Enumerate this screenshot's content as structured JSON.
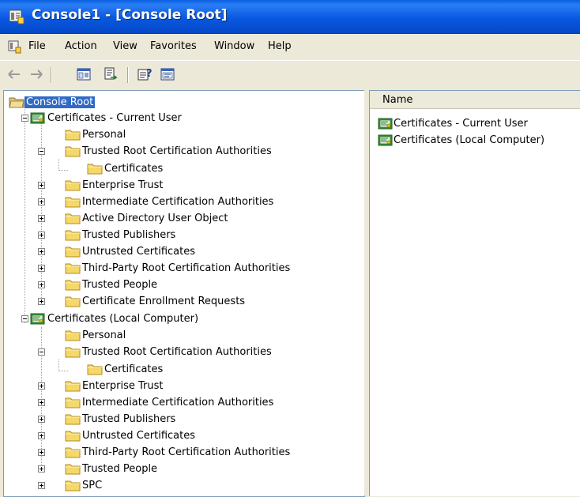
{
  "window": {
    "title": "Console1 - [Console Root]"
  },
  "menu": {
    "items": [
      "File",
      "Action",
      "View",
      "Favorites",
      "Window",
      "Help"
    ]
  },
  "toolbar": {
    "buttons": [
      "back-arrow-icon",
      "forward-arrow-icon",
      "show-hide-tree-icon",
      "export-list-icon",
      "help-icon",
      "properties-icon"
    ]
  },
  "tree": {
    "root": "Console Root",
    "current_user": {
      "label": "Certificates - Current User",
      "personal": "Personal",
      "trusted_root": "Trusted Root Certification Authorities",
      "trusted_root_certs": "Certificates",
      "enterprise_trust": "Enterprise Trust",
      "intermediate": "Intermediate Certification Authorities",
      "ad_user_object": "Active Directory User Object",
      "trusted_publishers": "Trusted Publishers",
      "untrusted": "Untrusted Certificates",
      "third_party_root": "Third-Party Root Certification Authorities",
      "trusted_people": "Trusted People",
      "enrollment_requests": "Certificate Enrollment Requests"
    },
    "local_computer": {
      "label": "Certificates (Local Computer)",
      "personal": "Personal",
      "trusted_root": "Trusted Root Certification Authorities",
      "trusted_root_certs": "Certificates",
      "enterprise_trust": "Enterprise Trust",
      "intermediate": "Intermediate Certification Authorities",
      "trusted_publishers": "Trusted Publishers",
      "untrusted": "Untrusted Certificates",
      "third_party_root": "Third-Party Root Certification Authorities",
      "trusted_people": "Trusted People",
      "spc": "SPC"
    }
  },
  "list": {
    "column_name": "Name",
    "items": [
      "Certificates - Current User",
      "Certificates (Local Computer)"
    ]
  },
  "colors": {
    "titlebar": "#0858e0",
    "selection": "#316ac5",
    "folder": "#f5d86a"
  }
}
